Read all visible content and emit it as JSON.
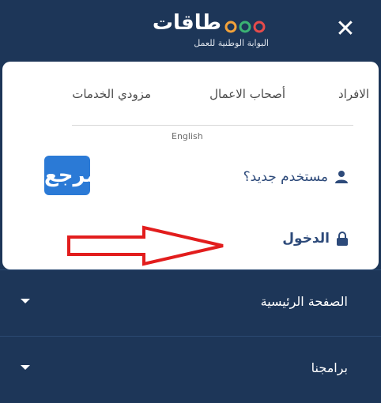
{
  "header": {
    "close_glyph": "✕",
    "logo_name": "طاقات",
    "logo_subtitle": "البوابة الوطنية للعمل"
  },
  "tabs": [
    {
      "label": "الافراد"
    },
    {
      "label": "أصحاب الاعمال"
    },
    {
      "label": "مزودي الخدمات"
    }
  ],
  "language_link": "English",
  "badge_text": "المرجع",
  "links": {
    "new_user": "مستخدم جديد؟",
    "login": "الدخول"
  },
  "menu": [
    {
      "label": "الصفحة الرئيسية"
    },
    {
      "label": "برامجنا"
    }
  ],
  "colors": {
    "navy": "#1d3658",
    "link": "#2d4a7a",
    "arrow": "#e21d1d",
    "badge": "#2b7ad6"
  }
}
